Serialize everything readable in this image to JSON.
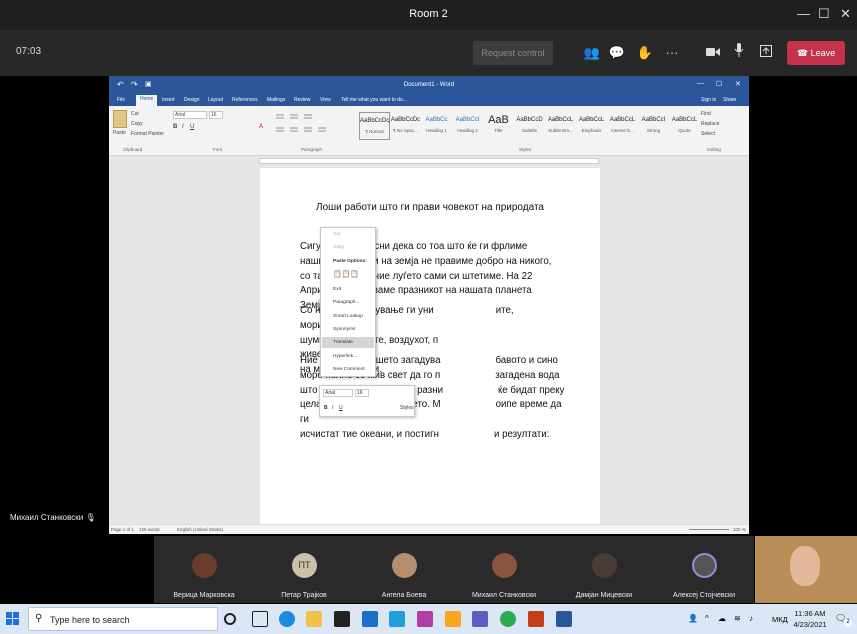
{
  "teams": {
    "window_title": "Room 2",
    "timer": "07:03",
    "request_control": "Request control",
    "leave_label": "Leave",
    "self_name": "Михаил Станковски"
  },
  "word": {
    "quick_title": "Document1 - Word",
    "tabs": [
      "File",
      "Home",
      "Insert",
      "Design",
      "Layout",
      "References",
      "Mailings",
      "Review",
      "View"
    ],
    "tell_me": "Tell me what you want to do...",
    "sign_in": "Sign in",
    "share": "Share",
    "clipboard": {
      "paste": "Paste",
      "cut": "Cut",
      "copy": "Copy",
      "format_painter": "Format Painter",
      "group": "Clipboard"
    },
    "font": {
      "name": "Arial",
      "size": "16",
      "group": "Font"
    },
    "paragraph_group": "Paragraph",
    "styles_group": "Styles",
    "styles": [
      {
        "preview": "AaBbCcDc",
        "name": "¶ Normal"
      },
      {
        "preview": "AaBbCcDc",
        "name": "¶ No Spac..."
      },
      {
        "preview": "AaBbCc",
        "name": "Heading 1"
      },
      {
        "preview": "AaBbCcI",
        "name": "Heading 2"
      },
      {
        "preview": "AaB",
        "name": "Title"
      },
      {
        "preview": "AaBbCcD",
        "name": "Subtitle"
      },
      {
        "preview": "AaBbCcL",
        "name": "Subtle Em..."
      },
      {
        "preview": "AaBbCcL",
        "name": "Emphasis"
      },
      {
        "preview": "AaBbCcL",
        "name": "Intense E..."
      },
      {
        "preview": "AaBbCcI",
        "name": "Strong"
      },
      {
        "preview": "AaBbCcL",
        "name": "Quote"
      }
    ],
    "editing": {
      "find": "Find",
      "replace": "Replace",
      "select": "Select",
      "group": "Editing"
    },
    "document": {
      "title": "Лоши работи што ги прави човекот на природата",
      "p1": "Сигурно сме свесни дека со тоа што ќе ги фрлиме нашите отпадоци на земја не правиме добро на никого, со таа постапка ние луѓето сами си штетиме. На 22 Април го празнуваме празникот на нашата планета Земја.",
      "p2a": "Со нашето загадување ги уни",
      "p2b": "ите, морињата,",
      "p2c": "шумите, полјаните, воздухот, п",
      "p2d": "живеалиштата",
      "p2e": "на многу животни.",
      "p3a": "Ние луѓето со нашето загадува",
      "p3b": "бавото и сино",
      "p3c": "море полно со жив свет да го п",
      "p3d": "загадена вода",
      "p3e": "што наместо риби ќе има разни",
      "p3f": "ќе бидат преку",
      "p3g": "целата површина на морето. М",
      "p3h": "оипе време да ги",
      "p3i": "исчистат тие океани, и постигн",
      "p3j": "и резултати:"
    },
    "context_menu": {
      "cut": "Cut",
      "copy": "Copy",
      "paste_options": "Paste Options:",
      "exit": "Exit",
      "paragraph": "Paragraph...",
      "smart_lookup": "Smart Lookup",
      "synonyms": "Synonyms",
      "translate": "Translate",
      "hyperlink": "Hyperlink...",
      "new_comment": "New Comment"
    },
    "mini_toolbar": {
      "font": "Arial",
      "size": "16",
      "styles": "Styles"
    },
    "status": {
      "page": "Page 1 of 1",
      "words": "126 words",
      "language": "English (United States)",
      "zoom": "100 %"
    }
  },
  "participants": [
    {
      "name": "Верица Марковска"
    },
    {
      "name": "Петар Трајков",
      "initials": "ПТ"
    },
    {
      "name": "Ангела Боева"
    },
    {
      "name": "Михаил Станковски"
    },
    {
      "name": "Дамјан Мицевски"
    },
    {
      "name": "Алексеј Стојчевски"
    }
  ],
  "taskbar": {
    "search_placeholder": "Type here to search",
    "time": "11:36 AM",
    "date": "4/23/2021",
    "language": "МКД",
    "notifications": "2"
  }
}
